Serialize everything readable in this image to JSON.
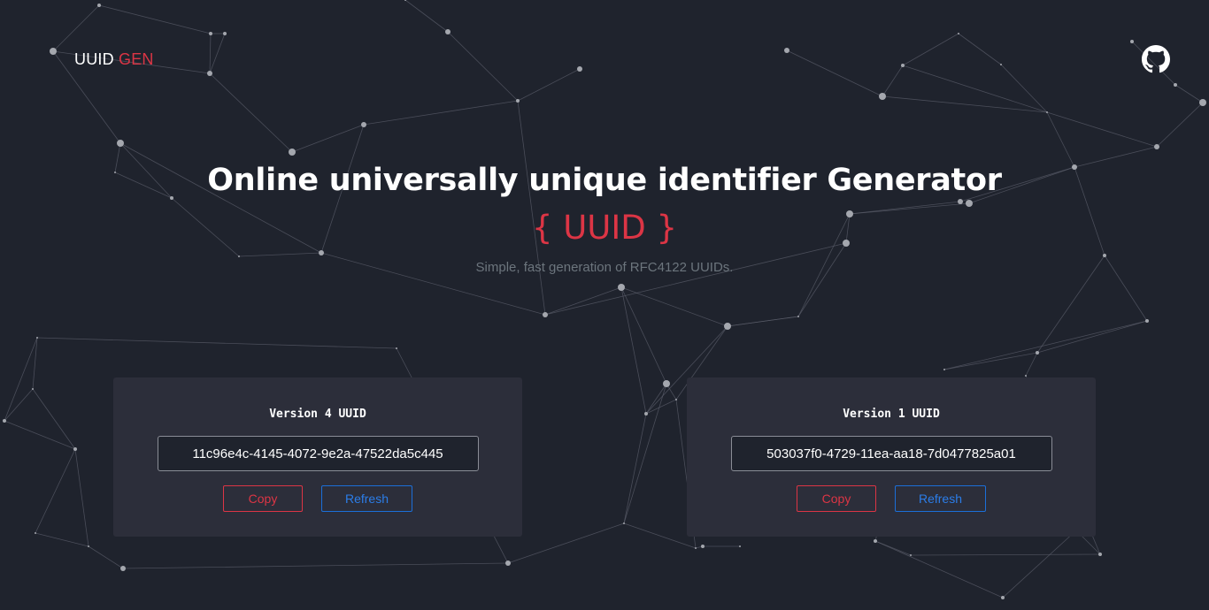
{
  "brand": {
    "text": "UUID",
    "accent": "GEN"
  },
  "header": {
    "github_icon": "github-icon"
  },
  "hero": {
    "title": "Online universally unique identifier Generator",
    "uuid": "{ UUID }",
    "subtitle": "Simple, fast generation of RFC4122 UUIDs."
  },
  "cards": {
    "v4": {
      "title": "Version 4 UUID",
      "value": "11c96e4c-4145-4072-9e2a-47522da5c445",
      "copy_label": "Copy",
      "refresh_label": "Refresh"
    },
    "v1": {
      "title": "Version 1 UUID",
      "value": "503037f0-4729-11ea-aa18-7d0477825a01",
      "copy_label": "Copy",
      "refresh_label": "Refresh"
    }
  },
  "colors": {
    "background": "#1f232d",
    "card": "#2c2e3a",
    "accent_red": "#dc3545",
    "accent_blue": "#2b7de9",
    "muted": "#6c757d"
  }
}
